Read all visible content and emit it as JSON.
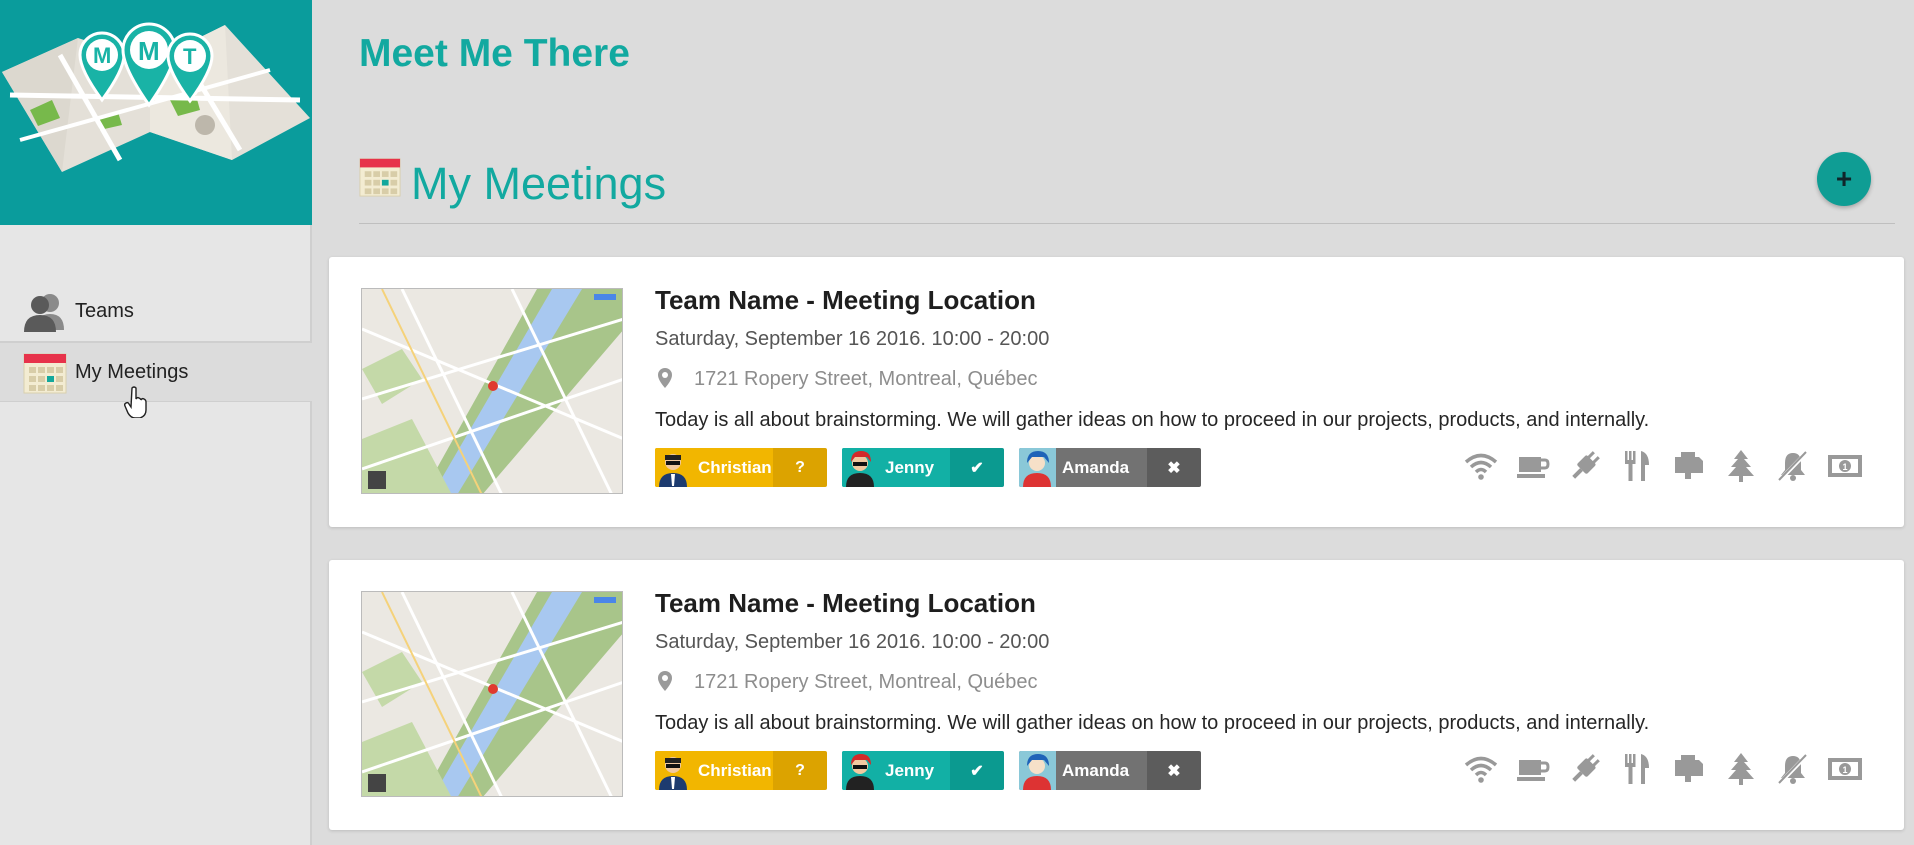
{
  "logo": {
    "letters": [
      "M",
      "M",
      "T"
    ]
  },
  "sidebar": {
    "items": [
      {
        "label": "Teams",
        "icon": "people-icon"
      },
      {
        "label": "My Meetings",
        "icon": "calendar-icon"
      }
    ]
  },
  "header": {
    "title": "Meet Me There"
  },
  "section": {
    "title": "My Meetings",
    "add_label": "+"
  },
  "meetings": [
    {
      "title": "Team Name - Meeting Location",
      "date": "Saturday, September 16 2016. 10:00 - 20:00",
      "address": "1721 Ropery Street, Montreal, Québec",
      "description": "Today is all about brainstorming. We will gather ideas on how to proceed in our projects, products, and internally.",
      "attendees": [
        {
          "name": "Christian",
          "status": "?",
          "color": "yellow"
        },
        {
          "name": "Jenny",
          "status": "✔",
          "color": "teal"
        },
        {
          "name": "Amanda",
          "status": "✖",
          "color": "gray"
        }
      ]
    },
    {
      "title": "Team Name - Meeting Location",
      "date": "Saturday, September 16 2016. 10:00 - 20:00",
      "address": "1721 Ropery Street, Montreal, Québec",
      "description": "Today is all about brainstorming. We will gather ideas on how to proceed in our projects, products, and internally.",
      "attendees": [
        {
          "name": "Christian",
          "status": "?",
          "color": "yellow"
        },
        {
          "name": "Jenny",
          "status": "✔",
          "color": "teal"
        },
        {
          "name": "Amanda",
          "status": "✖",
          "color": "gray"
        }
      ]
    }
  ],
  "amenities": [
    "wifi-icon",
    "coffee-icon",
    "power-plug-icon",
    "restaurant-icon",
    "printer-icon",
    "outdoor-tree-icon",
    "no-noise-icon",
    "money-icon"
  ],
  "colors": {
    "teal": "#12a9a0",
    "brand_bg": "#0a9c9c",
    "yellow": "#f2b600",
    "gray": "#727272"
  }
}
